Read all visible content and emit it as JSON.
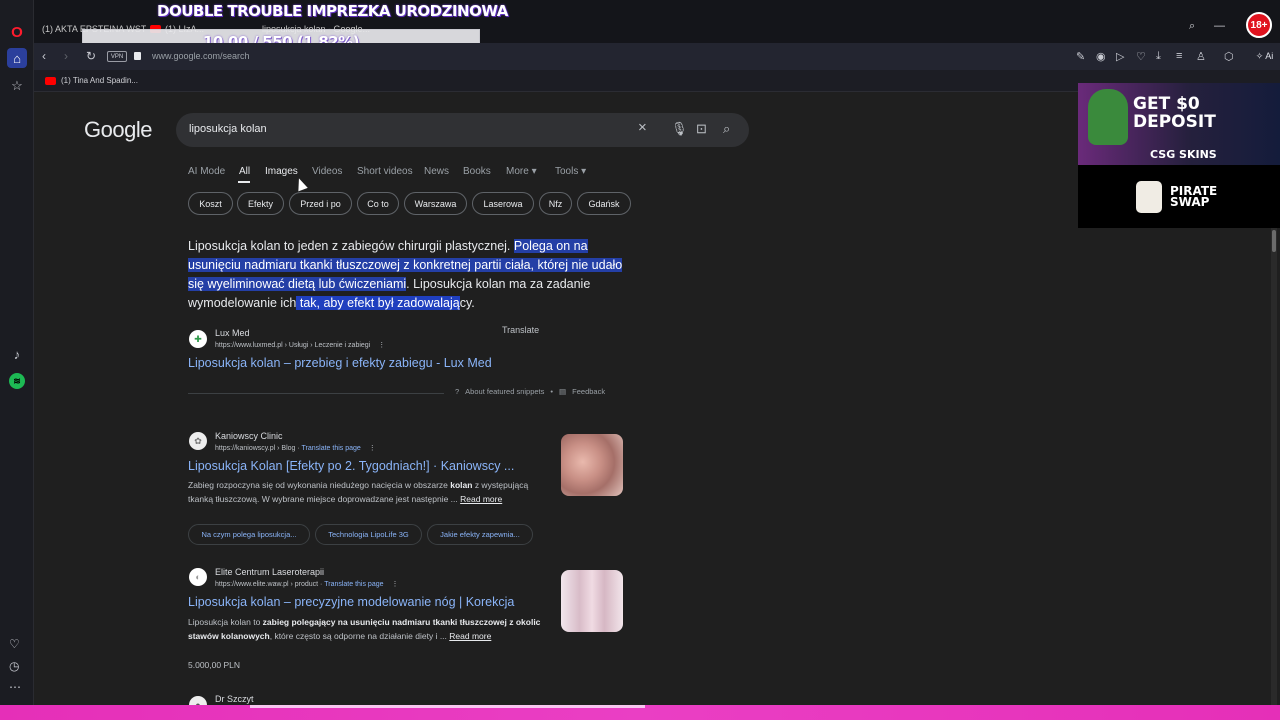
{
  "overlay": {
    "title": "DOUBLE TROUBLE IMPREZKA URODZINOWA",
    "counter": "10.00 / 550 (1.82%)",
    "age_badge": "18+"
  },
  "browser": {
    "tabs": [
      {
        "label": "(1) AKTA EPSTEINA WST..."
      },
      {
        "label": "(1) LIzA..."
      },
      {
        "label": "liposukcja kolan - Google..."
      }
    ],
    "url": "www.google.com/search",
    "vpn_label": "VPN",
    "ai_label": "Ai",
    "bookmark": "(1) Tina And Spadin..."
  },
  "google": {
    "logo": "Google",
    "query": "liposukcja kolan",
    "tabs": [
      "AI Mode",
      "All",
      "Images",
      "Videos",
      "Short videos",
      "News",
      "Books",
      "More",
      "Tools"
    ],
    "active_tab": "All",
    "chips": [
      "Koszt",
      "Efekty",
      "Przed i po",
      "Co to",
      "Warszawa",
      "Laserowa",
      "Nfz",
      "Gdańsk"
    ]
  },
  "featured": {
    "text_plain_1": "Liposukcja kolan to jeden z zabiegów chirurgii plastycznej. ",
    "text_hl_1": "Polega on na usunięciu nadmiaru tkanki tłuszczowej z konkretnej partii ciała, której nie udało się wyeliminować dietą lub ćwiczeniami",
    "text_plain_2": ". Liposukcja kolan ma za zadanie wymodelowanie ich",
    "text_hl_2": " tak, aby efekt był zadowalają",
    "text_plain_3": "cy.",
    "source_name": "Lux Med",
    "source_url": "https://www.luxmed.pl › Usługi › Leczenie i zabiegi",
    "translate": "Translate",
    "title": "Liposukcja kolan – przebieg i efekty zabiegu - Lux Med",
    "about": "About featured snippets",
    "feedback": "Feedback"
  },
  "results": [
    {
      "site": "Kaniowscy Clinic",
      "url": "https://kaniowscy.pl › Blog",
      "translate": "Translate this page",
      "title": "Liposukcja Kolan [Efekty po 2. Tygodniach!] · Kaniowscy ...",
      "desc_1": "Zabieg rozpoczyna się od wykonania niedużego nacięcia w obszarze ",
      "desc_b": "kolan",
      "desc_2": " z występującą tkanką tłuszczową. W wybrane miejsce doprowadzane jest następnie ... ",
      "read_more": "Read more",
      "chips": [
        "Na czym polega liposukcja...",
        "Technologia LipoLife 3G",
        "Jakie efekty zapewnia..."
      ]
    },
    {
      "site": "Elite Centrum Laseroterapii",
      "url": "https://www.elite.waw.pl › product",
      "translate": "Translate this page",
      "title": "Liposukcja kolan – precyzyjne modelowanie nóg | Korekcja",
      "desc_1": "Liposukcja kolan to ",
      "desc_b": "zabieg polegający na usunięciu nadmiaru tkanki tłuszczowej z okolic stawów kolanowych",
      "desc_2": ", które często są odporne na działanie diety i ... ",
      "read_more": "Read more",
      "price": "5.000,00 PLN"
    },
    {
      "site": "Dr Szczyt"
    }
  ],
  "ad": {
    "headline": "GET $0 DEPOSIT",
    "brand": "CSG SKINS",
    "partner": "PIRATE SWAP"
  }
}
